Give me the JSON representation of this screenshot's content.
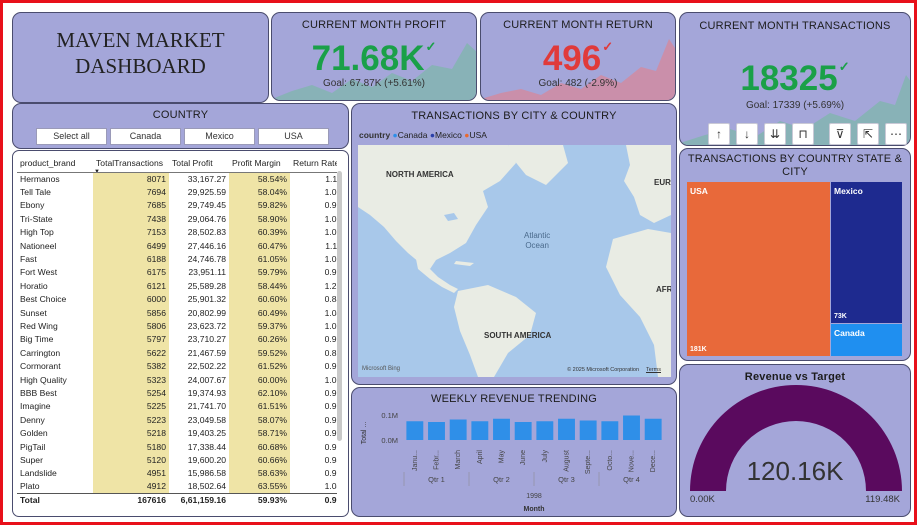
{
  "title": {
    "line1": "MAVEN MARKET",
    "line2": "DASHBOARD"
  },
  "kpis": {
    "profit": {
      "label": "CURRENT MONTH PROFIT",
      "value": "71.68K",
      "goal": "Goal: 67.87K (+5.61%)",
      "color": "#1aa048"
    },
    "return": {
      "label": "CURRENT MONTH RETURN",
      "value": "496",
      "goal": "Goal: 482 (-2.9%)",
      "color": "#e03a3a"
    },
    "transactions": {
      "label": "CURRENT MONTH TRANSACTIONS",
      "value": "18325",
      "goal": "Goal: 17339 (+5.69%)",
      "color": "#1aa048"
    }
  },
  "check_glyph": "✓",
  "country_slicer": {
    "label": "COUNTRY",
    "options": [
      "Select all",
      "Canada",
      "Mexico",
      "USA"
    ]
  },
  "table": {
    "columns": [
      "product_brand",
      "TotalTransactions",
      "Total Profit",
      "Profit Margin",
      "Return Rate"
    ],
    "sort_glyph": "▼",
    "rows": [
      [
        "Hermanos",
        "8071",
        "33,167.27",
        "58.54%",
        "1.11%"
      ],
      [
        "Tell Tale",
        "7694",
        "29,925.59",
        "58.04%",
        "1.00%"
      ],
      [
        "Ebony",
        "7685",
        "29,749.45",
        "59.82%",
        "0.95%"
      ],
      [
        "Tri-State",
        "7438",
        "29,064.76",
        "58.90%",
        "1.02%"
      ],
      [
        "High Top",
        "7153",
        "28,502.83",
        "60.39%",
        "1.01%"
      ],
      [
        "Nationeel",
        "6499",
        "27,446.16",
        "60.47%",
        "1.11%"
      ],
      [
        "Fast",
        "6188",
        "24,746.78",
        "61.05%",
        "1.09%"
      ],
      [
        "Fort West",
        "6175",
        "23,951.11",
        "59.79%",
        "0.92%"
      ],
      [
        "Horatio",
        "6121",
        "25,589.28",
        "58.44%",
        "1.25%"
      ],
      [
        "Best Choice",
        "6000",
        "25,901.32",
        "60.60%",
        "0.84%"
      ],
      [
        "Sunset",
        "5856",
        "20,802.99",
        "60.49%",
        "1.04%"
      ],
      [
        "Red Wing",
        "5806",
        "23,623.72",
        "59.37%",
        "1.09%"
      ],
      [
        "Big Time",
        "5797",
        "23,710.27",
        "60.26%",
        "0.97%"
      ],
      [
        "Carrington",
        "5622",
        "21,467.59",
        "59.52%",
        "0.89%"
      ],
      [
        "Cormorant",
        "5382",
        "22,502.22",
        "61.52%",
        "0.90%"
      ],
      [
        "High Quality",
        "5323",
        "24,007.67",
        "60.00%",
        "1.03%"
      ],
      [
        "BBB Best",
        "5254",
        "19,374.93",
        "62.10%",
        "0.90%"
      ],
      [
        "Imagine",
        "5225",
        "21,741.70",
        "61.51%",
        "0.98%"
      ],
      [
        "Denny",
        "5223",
        "23,049.58",
        "58.07%",
        "0.91%"
      ],
      [
        "Golden",
        "5218",
        "19,403.25",
        "58.71%",
        "0.91%"
      ],
      [
        "PigTail",
        "5180",
        "17,338.44",
        "60.68%",
        "0.96%"
      ],
      [
        "Super",
        "5120",
        "19,600.20",
        "60.66%",
        "0.94%"
      ],
      [
        "Landslide",
        "4951",
        "15,986.58",
        "58.63%",
        "0.97%"
      ],
      [
        "Plato",
        "4912",
        "18,502.64",
        "63.55%",
        "1.04%"
      ]
    ],
    "total": [
      "Total",
      "167616",
      "6,61,159.16",
      "59.93%",
      "0.99%"
    ]
  },
  "map": {
    "title": "TRANSACTIONS BY CITY & COUNTRY",
    "legend_label": "country",
    "legend": [
      {
        "name": "Canada",
        "color": "#2f8fe8"
      },
      {
        "name": "Mexico",
        "color": "#2a3fa8"
      },
      {
        "name": "USA",
        "color": "#e8692e"
      }
    ],
    "labels": {
      "north_america": "NORTH AMERICA",
      "south_america": "SOUTH AMERICA",
      "atlantic1": "Atlantic",
      "atlantic2": "Ocean",
      "europe": "EURO",
      "africa": "AFR"
    },
    "attribution": "© 2025 Microsoft Corporation",
    "terms": "Terms",
    "bing": "Microsoft Bing"
  },
  "treemap": {
    "title_line1": "TRANSACTIONS BY COUNTRY STATE &",
    "title_line2": "CITY",
    "cells": [
      {
        "name": "USA",
        "value": "181K",
        "color": "#e8693a"
      },
      {
        "name": "Mexico",
        "value": "73K",
        "color": "#1e2a8f"
      },
      {
        "name": "Canada",
        "value": "",
        "color": "#1f8ff0"
      }
    ]
  },
  "toolbar": {
    "icons": [
      "↑",
      "↓",
      "⇊",
      "⊓",
      "⊽",
      "⇱",
      "⋯"
    ]
  },
  "chart_data": [
    {
      "type": "bar",
      "title": "WEEKLY REVENUE TRENDING",
      "ylabel": "Total ...",
      "xlabel": "Month",
      "year_label": "1998",
      "yticks": [
        "0.1M",
        "0.0M"
      ],
      "ylim": [
        0,
        0.12
      ],
      "categories": [
        "January",
        "February",
        "March",
        "April",
        "May",
        "June",
        "July",
        "August",
        "September",
        "October",
        "November",
        "December"
      ],
      "category_labels": [
        "Janu...",
        "Febr...",
        "March",
        "April",
        "May",
        "June",
        "July",
        "August",
        "Septe...",
        "Octo...",
        "Nove...",
        "Dece..."
      ],
      "quarters": [
        "Qtr 1",
        "Qtr 2",
        "Qtr 3",
        "Qtr 4"
      ],
      "values": [
        0.075,
        0.072,
        0.082,
        0.075,
        0.085,
        0.072,
        0.075,
        0.085,
        0.078,
        0.075,
        0.098,
        0.085
      ],
      "color": "#2f8fe8"
    },
    {
      "type": "gauge",
      "title": "Revenue vs Target",
      "value_label": "120.16K",
      "min_label": "0.00K",
      "max_label": "119.48K",
      "value": 120.16,
      "max": 119.48,
      "color": "#5a0a5e"
    }
  ]
}
